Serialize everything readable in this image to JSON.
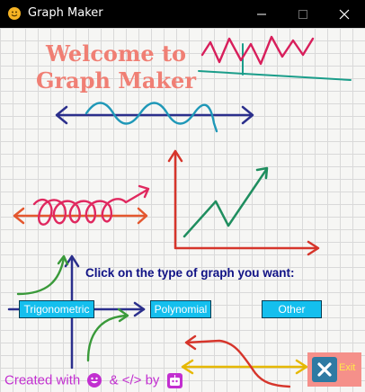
{
  "window": {
    "title": "Graph Maker",
    "app_icon": "smiley-face-icon",
    "controls": {
      "minimize": "minimize-icon",
      "maximize": "maximize-icon",
      "close": "close-icon"
    }
  },
  "main": {
    "welcome_line1": "Welcome to",
    "welcome_line2": "Graph Maker",
    "prompt": "Click on the type of graph you want:",
    "buttons": {
      "trigonometric": "Trigonometric",
      "polynomial": "Polynomial",
      "other": "Other"
    }
  },
  "footer": {
    "created_with": "Created with",
    "and_code_by": "& </> by",
    "exit_label": "Exit"
  },
  "colors": {
    "title_bar": "#000000",
    "welcome_text": "#f07f74",
    "prompt_text": "#101285",
    "graph_button": "#14bfee",
    "credit_text": "#c22fd0",
    "exit_button": "#f5908a",
    "exit_label": "#ffe94a"
  }
}
